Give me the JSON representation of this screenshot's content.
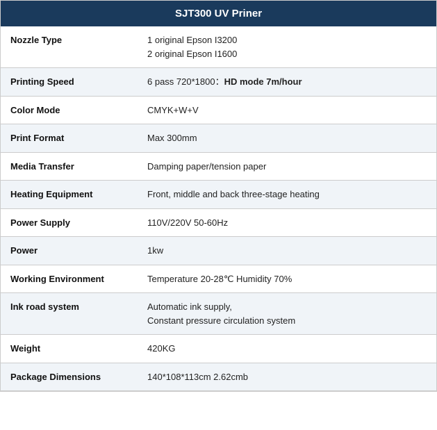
{
  "header": {
    "title": "SJT300 UV Priner"
  },
  "rows": [
    {
      "label": "Nozzle Type",
      "value": "1 original Epson I3200\n2 original Epson I1600",
      "value_html": "1 original Epson I3200<br>2 original Epson I1600"
    },
    {
      "label": "Printing Speed",
      "value": "6 pass 720*1800：HD mode 7m/hour",
      "value_normal": "6 pass 720*1800：",
      "value_bold": "HD mode 7m/hour"
    },
    {
      "label": "Color Mode",
      "value": "CMYK+W+V"
    },
    {
      "label": "Print Format",
      "value": "Max 300mm"
    },
    {
      "label": "Media Transfer",
      "value": "Damping paper/tension paper"
    },
    {
      "label": "Heating Equipment",
      "value": "Front, middle and back three-stage heating"
    },
    {
      "label": "Power Supply",
      "value": "110V/220V 50-60Hz"
    },
    {
      "label": "Power",
      "value": "1kw"
    },
    {
      "label": "Working Environment",
      "value": "Temperature 20-28℃ Humidity 70%"
    },
    {
      "label": "Ink road system",
      "value": "Automatic ink supply,\nConstant pressure circulation system",
      "value_html": "Automatic ink supply,<br>Constant pressure circulation system"
    },
    {
      "label": "Weight",
      "value": "420KG"
    },
    {
      "label": "Package Dimensions",
      "value": "140*108*113cm 2.62cmb"
    }
  ]
}
